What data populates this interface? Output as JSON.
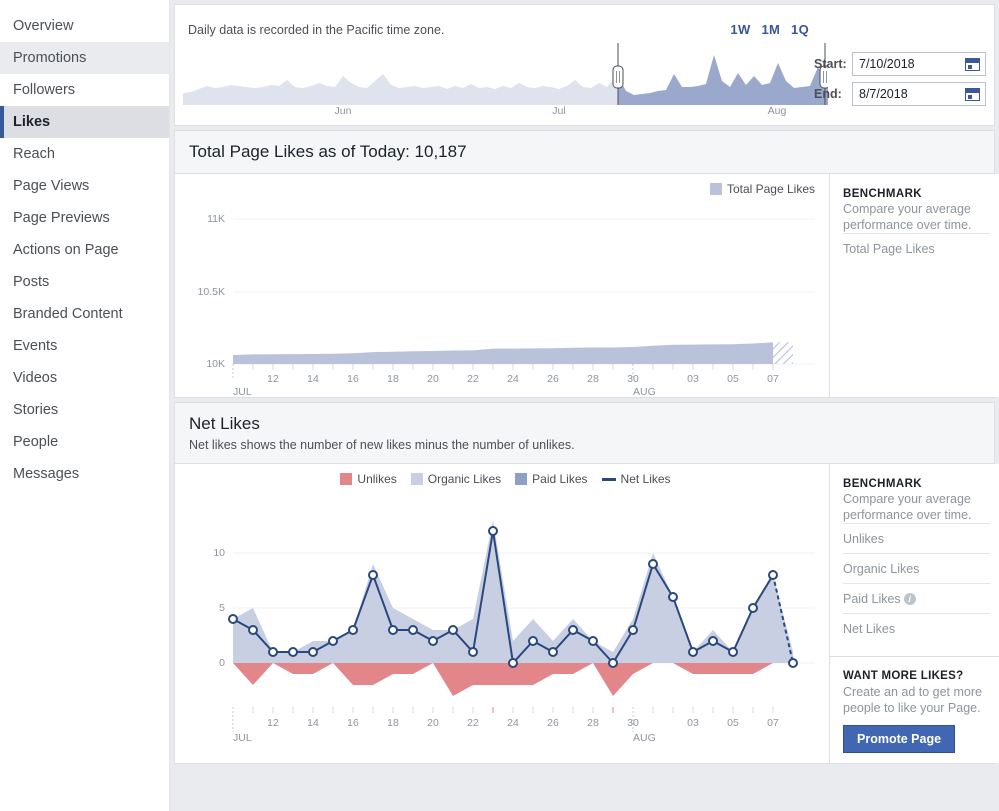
{
  "sidebar": {
    "items": [
      {
        "label": "Overview",
        "state": "normal"
      },
      {
        "label": "Promotions",
        "state": "shaded"
      },
      {
        "label": "Followers",
        "state": "normal"
      },
      {
        "label": "Likes",
        "state": "active"
      },
      {
        "label": "Reach",
        "state": "normal"
      },
      {
        "label": "Page Views",
        "state": "normal"
      },
      {
        "label": "Page Previews",
        "state": "normal"
      },
      {
        "label": "Actions on Page",
        "state": "normal"
      },
      {
        "label": "Posts",
        "state": "normal"
      },
      {
        "label": "Branded Content",
        "state": "normal"
      },
      {
        "label": "Events",
        "state": "normal"
      },
      {
        "label": "Videos",
        "state": "normal"
      },
      {
        "label": "Stories",
        "state": "normal"
      },
      {
        "label": "People",
        "state": "normal"
      },
      {
        "label": "Messages",
        "state": "normal"
      }
    ]
  },
  "range": {
    "note": "Daily data is recorded in the Pacific time zone.",
    "presets": [
      "1W",
      "1M",
      "1Q"
    ],
    "start_label": "Start:",
    "start_value": "7/10/2018",
    "end_label": "End:",
    "end_value": "8/7/2018",
    "mini_months": [
      "Jun",
      "Jul",
      "Aug"
    ],
    "calendar_icon": "calendar-icon"
  },
  "total_likes": {
    "title": "Total Page Likes as of Today: 10,187",
    "benchmark_title": "BENCHMARK",
    "benchmark_desc": "Compare your average performance over time.",
    "benchmark_rows": [
      "Total Page Likes"
    ]
  },
  "net_likes": {
    "title": "Net Likes",
    "subtitle": "Net likes shows the number of new likes minus the number of unlikes.",
    "benchmark_title": "BENCHMARK",
    "benchmark_desc": "Compare your average performance over time.",
    "benchmark_rows": [
      "Unlikes",
      "Organic Likes",
      "Paid Likes",
      "Net Likes"
    ],
    "paid_likes_info_icon": "info-icon",
    "promo_title": "WANT MORE LIKES?",
    "promo_desc": "Create an ad to get more people to like your Page.",
    "promo_button": "Promote Page"
  },
  "colors": {
    "accent": "#365899",
    "brand_button": "#4267b2",
    "organic_likes": "#c8cfe3",
    "paid_likes": "#8ea0c4",
    "unlikes": "#e3868a",
    "net_line": "#29487d",
    "total_page_likes_area": "#b9c2da"
  },
  "chart_data": [
    {
      "type": "area",
      "id": "total-page-likes",
      "title": "Total Page Likes as of Today: 10,187",
      "legend": [
        "Total Page Likes"
      ],
      "legend_position": "top-right",
      "xlabel": "",
      "ylabel": "",
      "ylim": [
        10000,
        11000
      ],
      "yticks": [
        10000,
        10500,
        11000
      ],
      "ytick_labels": [
        "10K",
        "10.5K",
        "11K"
      ],
      "grid": true,
      "month_labels": [
        "JUL",
        "AUG"
      ],
      "xtick_labels": [
        "12",
        "14",
        "16",
        "18",
        "20",
        "22",
        "24",
        "26",
        "28",
        "30",
        "03",
        "05",
        "07"
      ],
      "x": [
        "7/10",
        "7/11",
        "7/12",
        "7/13",
        "7/14",
        "7/15",
        "7/16",
        "7/17",
        "7/18",
        "7/19",
        "7/20",
        "7/21",
        "7/22",
        "7/23",
        "7/24",
        "7/25",
        "7/26",
        "7/27",
        "7/28",
        "7/29",
        "7/30",
        "7/31",
        "8/1",
        "8/2",
        "8/3",
        "8/4",
        "8/5",
        "8/6",
        "8/7"
      ],
      "series": [
        {
          "name": "Total Page Likes",
          "color": "#b9c2da",
          "values": [
            10063,
            10066,
            10067,
            10068,
            10069,
            10071,
            10074,
            10082,
            10085,
            10088,
            10090,
            10093,
            10094,
            10106,
            10106,
            10108,
            10109,
            10112,
            10114,
            10114,
            10117,
            10126,
            10132,
            10133,
            10135,
            10136,
            10141,
            10149,
            10149
          ]
        }
      ],
      "projected_last_point": true
    },
    {
      "type": "line",
      "id": "net-likes",
      "title": "Net Likes",
      "subtitle": "Net likes shows the number of new likes minus the number of unlikes.",
      "legend": [
        "Unlikes",
        "Organic Likes",
        "Paid Likes",
        "Net Likes"
      ],
      "legend_position": "top-center",
      "xlabel": "",
      "ylabel": "",
      "ylim": [
        -4,
        13
      ],
      "yticks": [
        0,
        5,
        10
      ],
      "ytick_labels": [
        "0",
        "5",
        "10"
      ],
      "grid": true,
      "month_labels": [
        "JUL",
        "AUG"
      ],
      "xtick_labels": [
        "12",
        "14",
        "16",
        "18",
        "20",
        "22",
        "24",
        "26",
        "28",
        "30",
        "03",
        "05",
        "07"
      ],
      "x": [
        "7/10",
        "7/11",
        "7/12",
        "7/13",
        "7/14",
        "7/15",
        "7/16",
        "7/17",
        "7/18",
        "7/19",
        "7/20",
        "7/21",
        "7/22",
        "7/23",
        "7/24",
        "7/25",
        "7/26",
        "7/27",
        "7/28",
        "7/29",
        "7/30",
        "7/31",
        "8/1",
        "8/2",
        "8/3",
        "8/4",
        "8/5",
        "8/6",
        "8/7"
      ],
      "series": [
        {
          "name": "Net Likes",
          "color": "#29487d",
          "values": [
            4,
            3,
            1,
            1,
            1,
            2,
            3,
            8,
            3,
            3,
            2,
            3,
            1,
            12,
            0,
            2,
            1,
            3,
            2,
            0,
            3,
            9,
            6,
            1,
            2,
            1,
            5,
            8,
            0
          ]
        },
        {
          "name": "Organic Likes",
          "color": "#c8cfe3",
          "values": [
            4,
            5,
            1,
            1,
            2,
            2,
            3,
            9,
            5,
            4,
            3,
            3,
            4,
            13,
            2,
            4,
            2,
            4,
            2,
            1,
            4,
            10,
            6,
            1,
            3,
            1,
            5,
            8,
            1
          ]
        },
        {
          "name": "Paid Likes",
          "color": "#8ea0c4",
          "values": [
            0,
            0,
            0,
            0,
            0,
            0,
            0,
            0,
            0,
            0,
            0,
            0,
            0,
            0,
            0,
            0,
            0,
            0,
            0,
            0,
            0,
            0,
            0,
            0,
            0,
            0,
            0,
            0,
            0
          ]
        },
        {
          "name": "Unlikes",
          "color": "#e3868a",
          "values": [
            0,
            -2,
            0,
            -1,
            -1,
            0,
            -2,
            -2,
            -1,
            -1,
            0,
            -3,
            -2,
            -2,
            -2,
            -2,
            -1,
            -1,
            0,
            -3,
            -1,
            0,
            0,
            -1,
            -1,
            -1,
            -1,
            0,
            0
          ]
        }
      ],
      "projected_last_point": true
    }
  ]
}
